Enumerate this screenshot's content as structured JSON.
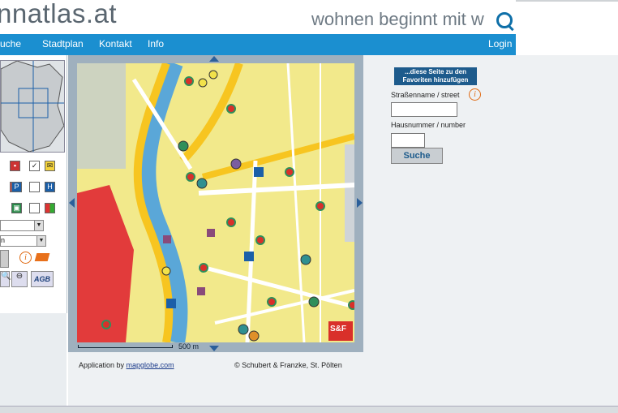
{
  "header": {
    "logo": "nnatlas.at",
    "tagline": "wohnen beginnt mit w",
    "tagline_icon": "magnifier-icon"
  },
  "nav": {
    "items": [
      {
        "label": "uche"
      },
      {
        "label": "Stadtplan"
      },
      {
        "label": "Kontakt"
      },
      {
        "label": "Info"
      }
    ],
    "login": "Login"
  },
  "map": {
    "scale": "500 m",
    "badge": "S&F"
  },
  "footer": {
    "app_prefix": "Application by ",
    "app_link": "mapglobe.com",
    "copyright": "© Schubert & Franzke, St. Pölten"
  },
  "right": {
    "favorites_button": "...diese Seite zu den Favoriten hinzufügen",
    "street_label": "Straßenname / street",
    "number_label": "Hausnummer / number",
    "search_button": "Suche",
    "street_value": "",
    "number_value": ""
  },
  "left": {
    "agb": "AGB",
    "select1": "",
    "select2": "n"
  },
  "colors": {
    "nav": "#1b8fd0",
    "favbtn": "#1d5b8c",
    "map_bg": "#f2e98b",
    "road": "#f7c520",
    "river": "#5aa7d8",
    "poi_red": "#d9302a",
    "poi_green": "#2f8f5a"
  }
}
